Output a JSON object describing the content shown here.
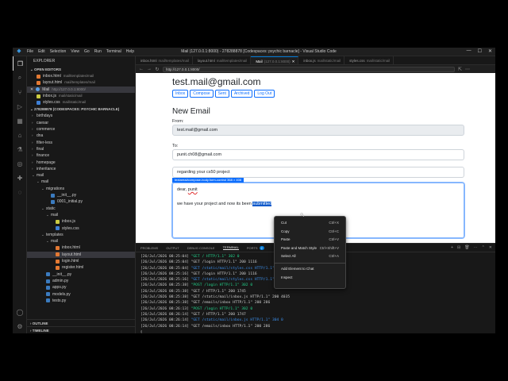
{
  "window": {
    "title": "Mail (127.0.0.1:8000) - 278288878 [Codespaces: psychic barnacle] - Visual Studio Code",
    "menu": [
      "File",
      "Edit",
      "Selection",
      "View",
      "Go",
      "Run",
      "Terminal",
      "Help"
    ],
    "controls": [
      "—",
      "☐",
      "✕"
    ]
  },
  "sidebar": {
    "title": "EXPLORER",
    "open_editors_label": "OPEN EDITORS",
    "open_editors": [
      {
        "name": "inbox.html",
        "hint": "mail/templates/mail",
        "icon": "html"
      },
      {
        "name": "layout.html",
        "hint": "mail/templates/mail",
        "icon": "html"
      },
      {
        "name": "Mail",
        "hint": "http://127.0.0.1:8000/",
        "icon": "globe",
        "prefix": "✕"
      },
      {
        "name": "inbox.js",
        "hint": "mail/static/mail",
        "icon": "js"
      },
      {
        "name": "styles.css",
        "hint": "mail/static/mail",
        "icon": "css"
      }
    ],
    "workspace_label": "278288878 (CODESPACES: PSYCHIC BARNACLE)",
    "tree": [
      {
        "name": "birthdays",
        "depth": 1,
        "arrow": "›"
      },
      {
        "name": "caesar",
        "depth": 1,
        "arrow": "›"
      },
      {
        "name": "commerce",
        "depth": 1,
        "arrow": "›"
      },
      {
        "name": "dna",
        "depth": 1,
        "arrow": "›"
      },
      {
        "name": "filter-less",
        "depth": 1,
        "arrow": "›"
      },
      {
        "name": "final",
        "depth": 1,
        "arrow": "›"
      },
      {
        "name": "finance",
        "depth": 1,
        "arrow": "›"
      },
      {
        "name": "homepage",
        "depth": 1,
        "arrow": "›"
      },
      {
        "name": "inheritance",
        "depth": 1,
        "arrow": "›"
      },
      {
        "name": "mail",
        "depth": 1,
        "arrow": "⌄"
      },
      {
        "name": "mail",
        "depth": 2,
        "arrow": "⌄"
      },
      {
        "name": "migrations",
        "depth": 3,
        "arrow": "⌄"
      },
      {
        "name": "__init__.py",
        "depth": 4,
        "icon": "py"
      },
      {
        "name": "0001_initial.py",
        "depth": 4,
        "icon": "py"
      },
      {
        "name": "static",
        "depth": 3,
        "arrow": "⌄"
      },
      {
        "name": "mail",
        "depth": 4,
        "arrow": "⌄"
      },
      {
        "name": "inbox.js",
        "depth": 5,
        "icon": "js"
      },
      {
        "name": "styles.css",
        "depth": 5,
        "icon": "css"
      },
      {
        "name": "templates",
        "depth": 3,
        "arrow": "⌄"
      },
      {
        "name": "mail",
        "depth": 4,
        "arrow": "⌄"
      },
      {
        "name": "inbox.html",
        "depth": 5,
        "icon": "html"
      },
      {
        "name": "layout.html",
        "depth": 5,
        "icon": "html",
        "selected": true
      },
      {
        "name": "login.html",
        "depth": 5,
        "icon": "html"
      },
      {
        "name": "register.html",
        "depth": 5,
        "icon": "html"
      },
      {
        "name": "__init__.py",
        "depth": 3,
        "icon": "py"
      },
      {
        "name": "admin.py",
        "depth": 3,
        "icon": "py"
      },
      {
        "name": "apps.py",
        "depth": 3,
        "icon": "py"
      },
      {
        "name": "models.py",
        "depth": 3,
        "icon": "py"
      },
      {
        "name": "tests.py",
        "depth": 3,
        "icon": "py"
      }
    ],
    "outline_label": "OUTLINE",
    "timeline_label": "TIMELINE"
  },
  "tabs": [
    {
      "name": "inbox.html",
      "hint": "mail/templates/mail",
      "icon": "html"
    },
    {
      "name": "layout.html",
      "hint": "mail/templates/mail",
      "icon": "html"
    },
    {
      "name": "Mail",
      "hint": "(127.0.0.1:8000)",
      "icon": "globe",
      "active": true
    },
    {
      "name": "inbox.js",
      "hint": "mail/static/mail",
      "icon": "js"
    },
    {
      "name": "styles.css",
      "hint": "mail/static/mail",
      "icon": "css"
    }
  ],
  "browser": {
    "url": "http://127.0.0.1:8000/"
  },
  "page": {
    "user_email": "test.mail@gmail.com",
    "nav": [
      "Inbox",
      "Compose",
      "Sent",
      "Archived",
      "Log Out"
    ],
    "heading": "New Email",
    "from_label": "From:",
    "from_value": "test.mail@gmail.com",
    "to_label": "To:",
    "to_value": "punit.ch08@gmail.com",
    "subject_value": "regarding your cs50 project",
    "tooltip": "textarea#compose-body.form-control  368 × 408",
    "body_line1_pre": "dear, ",
    "body_line1_word": "punit",
    "body_line2_pre": "we have your project and now its been ",
    "body_line2_sel": "submitted"
  },
  "context_menu": [
    {
      "label": "Cut",
      "shortcut": "Ctrl+X"
    },
    {
      "label": "Copy",
      "shortcut": "Ctrl+C"
    },
    {
      "label": "Paste",
      "shortcut": "Ctrl+V"
    },
    {
      "label": "Paste and Match Style",
      "shortcut": "Ctrl+Shift+V"
    },
    {
      "label": "Select All",
      "shortcut": "Ctrl+A"
    },
    {
      "sep": true
    },
    {
      "label": "Add Element to Chat",
      "shortcut": ""
    },
    {
      "label": "Inspect",
      "shortcut": ""
    }
  ],
  "panel": {
    "tabs": [
      "PROBLEMS",
      "OUTPUT",
      "DEBUG CONSOLE",
      "TERMINAL",
      "PORTS"
    ],
    "active_tab": "TERMINAL",
    "ports_count": "2",
    "lines": [
      {
        "ts": "[26/Jul/2026 08:25:04]",
        "req": "\"GET / HTTP/1.1\" 302 0",
        "c": "g"
      },
      {
        "ts": "[26/Jul/2026 08:25:04]",
        "req": "\"GET /login HTTP/1.1\" 200 1116",
        "c": ""
      },
      {
        "ts": "[26/Jul/2026 08:25:04]",
        "req": "\"GET /static/mail/styles.css HTTP/1.1\" 304 0",
        "c": "b"
      },
      {
        "ts": "[26/Jul/2026 08:25:16]",
        "req": "\"GET /login HTTP/1.1\" 200 1116",
        "c": ""
      },
      {
        "ts": "[26/Jul/2026 08:25:16]",
        "req": "\"GET /static/mail/styles.css HTTP/1.1\" 304 0",
        "c": "b"
      },
      {
        "ts": "[26/Jul/2026 08:25:38]",
        "req": "\"POST /login HTTP/1.1\" 302 0",
        "c": "g"
      },
      {
        "ts": "[26/Jul/2026 08:25:38]",
        "req": "\"GET / HTTP/1.1\" 200 1745",
        "c": ""
      },
      {
        "ts": "[26/Jul/2026 08:25:38]",
        "req": "\"GET /static/mail/inbox.js HTTP/1.1\" 200 4035",
        "c": ""
      },
      {
        "ts": "[26/Jul/2026 08:25:38]",
        "req": "\"GET /emails/inbox HTTP/1.1\" 200 286",
        "c": ""
      },
      {
        "ts": "[26/Jul/2026 08:26:13]",
        "req": "\"POST /login HTTP/1.1\" 302 0",
        "c": "g"
      },
      {
        "ts": "[26/Jul/2026 08:26:14]",
        "req": "\"GET / HTTP/1.1\" 200 1747",
        "c": ""
      },
      {
        "ts": "[26/Jul/2026 08:26:14]",
        "req": "\"GET /static/mail/inbox.js HTTP/1.1\" 304 0",
        "c": "b"
      },
      {
        "ts": "[26/Jul/2026 08:26:14]",
        "req": "\"GET /emails/inbox HTTP/1.1\" 200 286",
        "c": ""
      }
    ]
  }
}
